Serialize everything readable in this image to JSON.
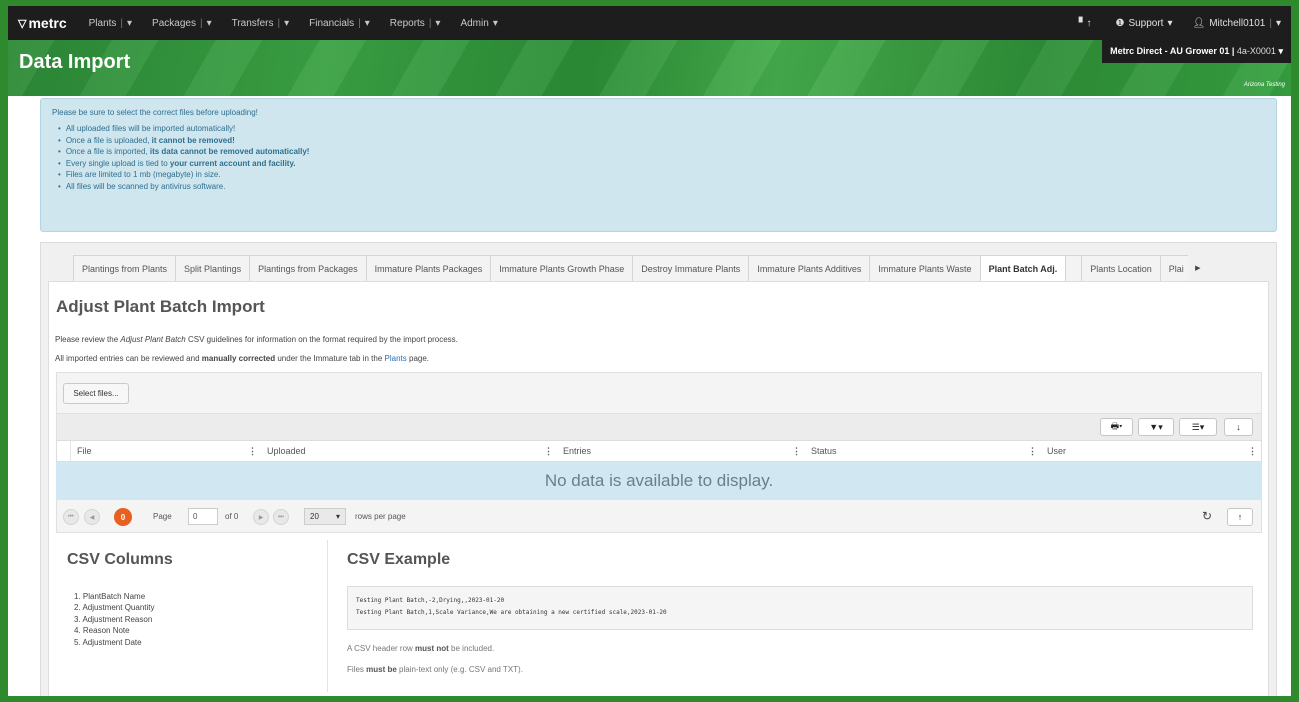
{
  "nav": {
    "brand": "metrc",
    "items": [
      {
        "label": "Plants"
      },
      {
        "label": "Packages"
      },
      {
        "label": "Transfers"
      },
      {
        "label": "Financials"
      },
      {
        "label": "Reports"
      },
      {
        "label": "Admin"
      }
    ],
    "support": "Support",
    "user": "Mitchell0101"
  },
  "header": {
    "title": "Data Import",
    "facility_name": "Metrc Direct - AU Grower 01",
    "facility_code": "4a-X0001",
    "environment": "Arizona Testing"
  },
  "alert": {
    "heading": "Please be sure to select the correct files before uploading!",
    "items": [
      {
        "pre": "All uploaded files will be imported automatically!",
        "bold": "",
        "post": ""
      },
      {
        "pre": "Once a file is uploaded, ",
        "bold": "it cannot be removed!",
        "post": ""
      },
      {
        "pre": "Once a file is imported, ",
        "bold": "its data cannot be removed automatically!",
        "post": ""
      },
      {
        "pre": "Every single upload is tied to ",
        "bold": "your current account and facility.",
        "post": ""
      },
      {
        "pre": "Files are limited to 1 mb (megabyte) in size.",
        "bold": "",
        "post": ""
      },
      {
        "pre": "All files will be scanned by antivirus software.",
        "bold": "",
        "post": ""
      }
    ]
  },
  "tabs": [
    {
      "label": "Plantings from Plants"
    },
    {
      "label": "Split Plantings"
    },
    {
      "label": "Plantings from Packages"
    },
    {
      "label": "Immature Plants Packages"
    },
    {
      "label": "Immature Plants Growth Phase"
    },
    {
      "label": "Destroy Immature Plants"
    },
    {
      "label": "Immature Plants Additives"
    },
    {
      "label": "Immature Plants Waste"
    },
    {
      "label": "Plant Batch Adj."
    },
    {
      "label": ""
    },
    {
      "label": "Plants Location"
    },
    {
      "label": "Plai"
    }
  ],
  "active_tab": "Plant Batch Adj.",
  "section": {
    "title": "Adjust Plant Batch Import",
    "line1_pre": "Please review the ",
    "line1_em": "Adjust Plant Batch",
    "line1_post": " CSV guidelines for information on the format required by the import process.",
    "line2_pre": "All imported entries can be reviewed and ",
    "line2_bold": "manually corrected",
    "line2_mid": " under the Immature tab in the ",
    "line2_link": "Plants",
    "line2_post": " page."
  },
  "select_files": "Select files...",
  "grid": {
    "columns": [
      "File",
      "Uploaded",
      "Entries",
      "Status",
      "User"
    ],
    "empty_message": "No data is available to display."
  },
  "pager": {
    "badge": "0",
    "page_label": "Page",
    "page_value": "0",
    "of_label": "of 0",
    "page_size": "20",
    "rows_label": "rows per page"
  },
  "csv": {
    "columns_title": "CSV Columns",
    "columns": [
      "1. PlantBatch Name",
      "2. Adjustment Quantity",
      "3. Adjustment Reason",
      "4. Reason Note",
      "5. Adjustment Date"
    ],
    "example_title": "CSV Example",
    "example_lines": [
      "Testing Plant Batch,-2,Drying,,2023-01-20",
      "Testing Plant Batch,1,Scale Variance,We are obtaining a new certified scale,2023-01-20"
    ],
    "note1_pre": "A CSV header row ",
    "note1_bold": "must not",
    "note1_post": " be included.",
    "note2_pre": "Files ",
    "note2_bold": "must be",
    "note2_post": " plain-text only (e.g. CSV and TXT)."
  }
}
